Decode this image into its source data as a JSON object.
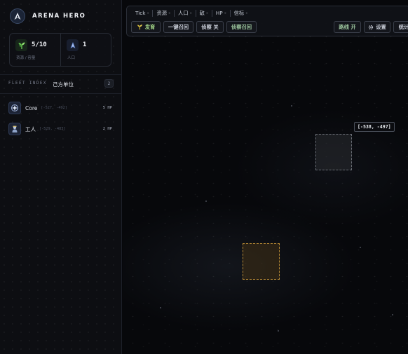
{
  "app": {
    "title": "ARENA HERO"
  },
  "stats": {
    "resources": {
      "value": "5/10",
      "label": "资源 / 容量",
      "icon": "sprout-icon"
    },
    "population": {
      "value": "1",
      "label": "人口",
      "icon": "ship-icon"
    }
  },
  "fleet": {
    "title": "FLEET INDEX",
    "side": "己方单位",
    "count": "2",
    "units": [
      {
        "name": "Core",
        "coords": "[-527, -492]",
        "hp": "5 HP",
        "icon": "core-icon"
      },
      {
        "name": "工人",
        "coords": "[-529, -483]",
        "hp": "2 HP",
        "icon": "worker-icon"
      }
    ]
  },
  "toolbar": {
    "chips": [
      "Tick -",
      "资源 -",
      "人口 -",
      "敌 -",
      "HP -",
      "信标 -"
    ],
    "buttons": {
      "grow": "发育",
      "recall_all": "一键召回",
      "scout_toggle": "侦察 关",
      "scout_recall": "侦察召回",
      "route_toggle": "路线 开",
      "settings": "设置",
      "stats": "统计"
    }
  },
  "map": {
    "hover_coord": "[-538, -497]"
  },
  "colors": {
    "accent_green": "#a6d98a",
    "build_outline": "#b88a34",
    "background": "#07080b"
  }
}
